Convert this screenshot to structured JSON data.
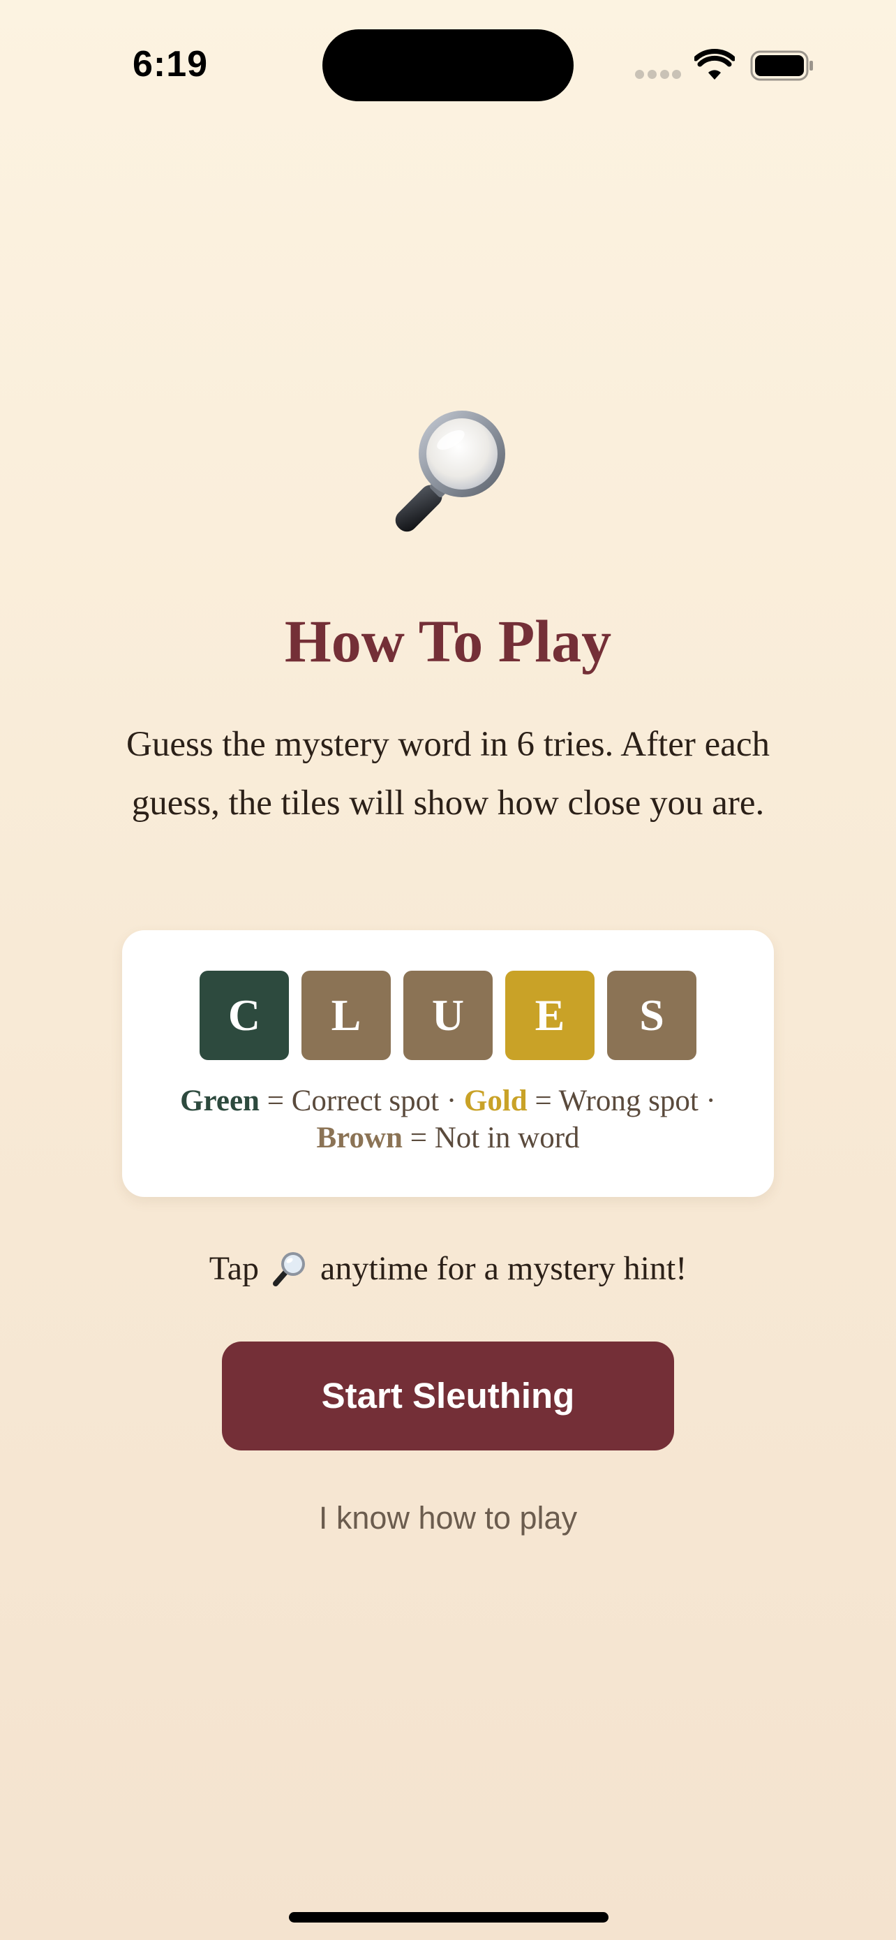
{
  "status_bar": {
    "time": "6:19",
    "icons": [
      "signal-icon",
      "wifi-icon",
      "battery-icon"
    ]
  },
  "header": {
    "icon": "magnifying-glass-icon",
    "title": "How To Play"
  },
  "intro_text": "Guess the mystery word in 6 tries. After each guess, the tiles will show how close you are.",
  "example": {
    "tiles": [
      {
        "letter": "C",
        "state": "correct"
      },
      {
        "letter": "L",
        "state": "absent"
      },
      {
        "letter": "U",
        "state": "absent"
      },
      {
        "letter": "E",
        "state": "present"
      },
      {
        "letter": "S",
        "state": "absent"
      }
    ],
    "legend": {
      "green_label": "Green",
      "green_desc": "= Correct spot ·",
      "gold_label": "Gold",
      "gold_desc": "= Wrong spot ·",
      "brown_label": "Brown",
      "brown_desc": "= Not in word"
    }
  },
  "hint": {
    "prefix": "Tap",
    "icon": "magnifying-glass-icon",
    "suffix": "anytime for a mystery hint!"
  },
  "actions": {
    "primary_label": "Start Sleuthing",
    "secondary_label": "I know how to play"
  },
  "colors": {
    "accent": "#742f37",
    "correct": "#2d4a3e",
    "present": "#c9a227",
    "absent": "#8b7355",
    "background": "#fcf3e1"
  }
}
